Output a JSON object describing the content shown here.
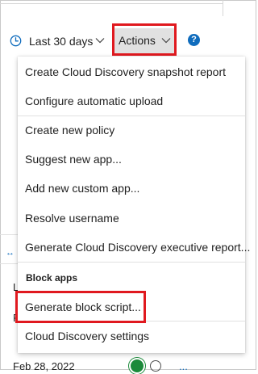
{
  "toolbar": {
    "date_range": "Last 30 days",
    "actions_label": "Actions",
    "help_glyph": "?"
  },
  "icons": {
    "clock": "clock-icon",
    "date_chevron": "chevron-down-icon",
    "actions_chevron": "chevron-down-icon",
    "help": "help-icon",
    "status": "check-circle-icon",
    "block": "block-icon"
  },
  "menu": {
    "items": [
      {
        "label": "Create Cloud Discovery snapshot report"
      },
      {
        "label": "Configure automatic upload"
      },
      {
        "label": "Create new policy"
      },
      {
        "label": "Suggest new app..."
      },
      {
        "label": "Add new custom app..."
      },
      {
        "label": "Resolve username"
      },
      {
        "label": "Generate Cloud Discovery executive report..."
      },
      {
        "label": "Generate block script..."
      },
      {
        "label": "Cloud Discovery settings"
      }
    ],
    "block_header": "Block apps"
  },
  "background": {
    "arrow_glyph": "↔",
    "letter_l": "L",
    "letter_f": "F",
    "date_text": "Feb 28, 2022",
    "more_glyph": "..."
  },
  "colors": {
    "highlight": "#e0191f",
    "accent": "#0f6cbd",
    "actions_bg": "#e1e1e1",
    "status_green": "#1b8a3a"
  }
}
